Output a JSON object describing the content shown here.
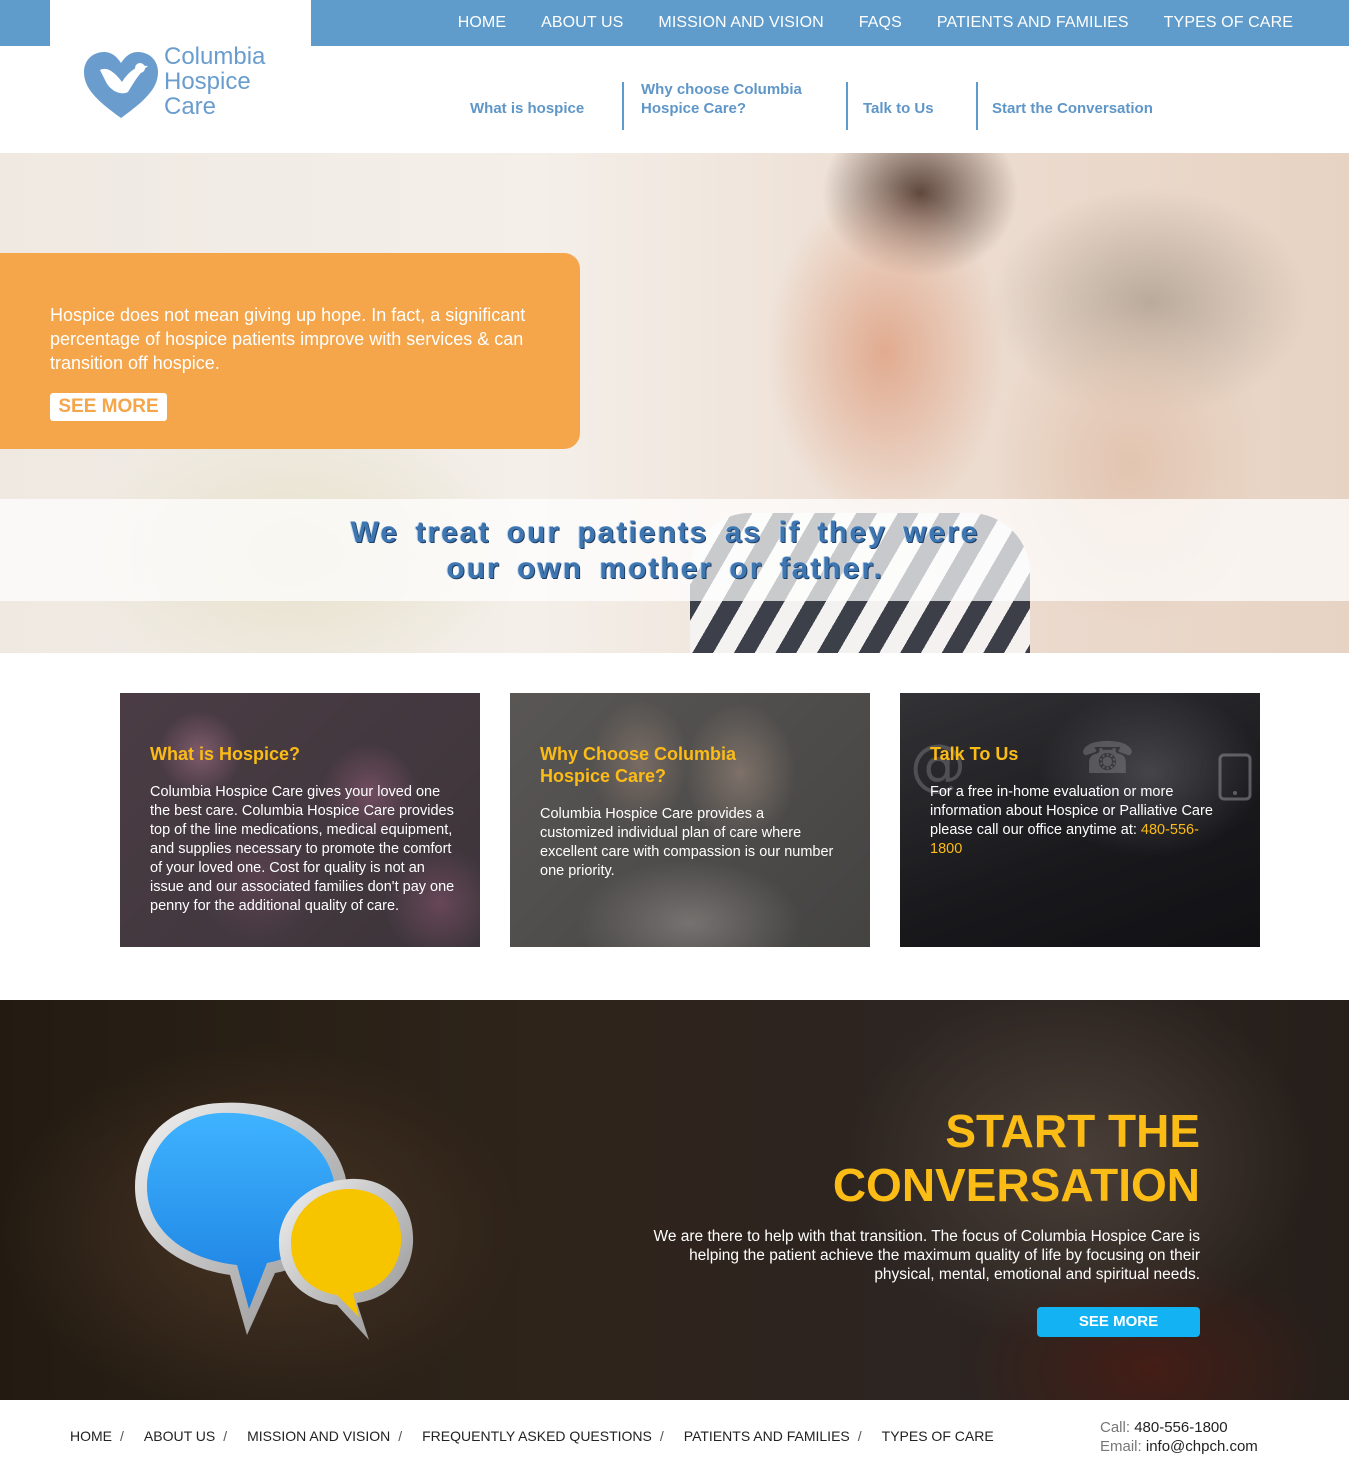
{
  "header": {
    "logo_lines": [
      "Columbia",
      "Hospice",
      "Care"
    ],
    "main_nav": [
      "HOME",
      "ABOUT US",
      "MISSION AND VISION",
      "FAQS",
      "PATIENTS AND FAMILIES",
      "TYPES OF CARE"
    ],
    "sub_nav": [
      {
        "label": "What is hospice"
      },
      {
        "label": "Why choose Columbia Hospice Care?"
      },
      {
        "label": "Talk to Us"
      },
      {
        "label": "Start the Conversation"
      }
    ]
  },
  "hero": {
    "callout_text": "Hospice does not mean giving up hope. In fact, a significant percentage of hospice patients improve with services & can transition off hospice.",
    "see_more_label": "SEE MORE",
    "tagline": "We treat our patients as if they were our own mother or father."
  },
  "cards": [
    {
      "title": "What is Hospice?",
      "text": "Columbia Hospice Care gives your loved one the best care. Columbia Hospice Care provides top of the line medications, medical equipment, and supplies necessary to promote the comfort of your loved one. Cost for quality is not an issue and our associated families don't pay one penny for the additional quality of care."
    },
    {
      "title": "Why Choose Columbia Hospice Care?",
      "text": "Columbia Hospice Care provides a customized individual plan of care where excellent care with compassion is our number one priority."
    },
    {
      "title": "Talk To Us",
      "text": "For a free in-home evaluation or more information about Hospice or Palliative Care please call our office anytime at:",
      "phone": "480-556-1800"
    }
  ],
  "conversation": {
    "title_line1": "START THE",
    "title_line2": "CONVERSATION",
    "text": "We are there to help with that transition. The focus of Columbia Hospice Care is helping the patient achieve the maximum quality of life by focusing on their physical, mental, emotional and spiritual needs.",
    "button_label": "SEE MORE"
  },
  "footer": {
    "nav": [
      "HOME",
      "ABOUT US",
      "MISSION AND VISION",
      "FREQUENTLY ASKED QUESTIONS",
      "PATIENTS AND FAMILIES",
      "TYPES OF CARE"
    ],
    "separator": "/",
    "call_label": "Call:",
    "call_value": "480-556-1800",
    "email_label": "Email:",
    "email_value": "info@chpch.com"
  },
  "colors": {
    "brand_blue": "#5f9ccb",
    "accent_orange": "#f5a54a",
    "accent_yellow": "#fcbc16",
    "button_cyan": "#13b3f3"
  },
  "icons": [
    "heart-dove-logo-icon",
    "at-sign-icon",
    "telephone-icon",
    "tablet-icon",
    "speech-bubbles-icon"
  ]
}
